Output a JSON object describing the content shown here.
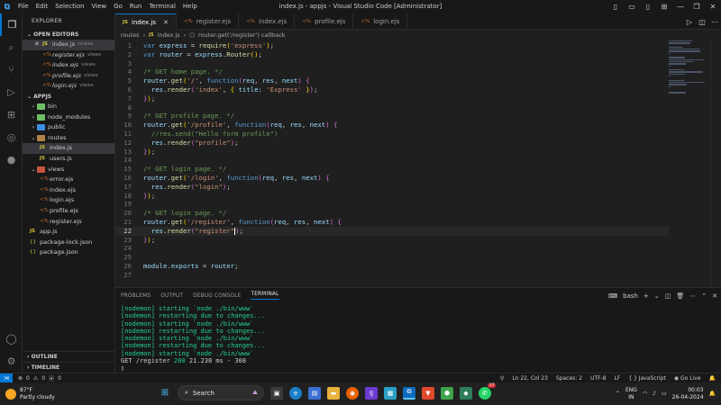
{
  "window": {
    "title": "index.js - appjs - Visual Studio Code [Administrator]",
    "menu": [
      "File",
      "Edit",
      "Selection",
      "View",
      "Go",
      "Run",
      "Terminal",
      "Help"
    ]
  },
  "sidebar": {
    "title": "EXPLORER",
    "open_editors_label": "OPEN EDITORS",
    "open_editors": [
      {
        "icon": "JS",
        "name": "index.js",
        "folder": "routes",
        "selected": true
      },
      {
        "icon": "<%",
        "name": "register.ejs",
        "folder": "views"
      },
      {
        "icon": "<%",
        "name": "index.ejs",
        "folder": "views"
      },
      {
        "icon": "<%",
        "name": "profile.ejs",
        "folder": "views"
      },
      {
        "icon": "<%",
        "name": "login.ejs",
        "folder": "views"
      }
    ],
    "project_label": "APPJS",
    "tree": [
      {
        "chev": "›",
        "name": "bin",
        "folder_color": "#6dbf67",
        "depth": 0
      },
      {
        "chev": "›",
        "name": "node_modules",
        "folder_color": "#6dbf67",
        "depth": 0
      },
      {
        "chev": "›",
        "name": "public",
        "folder_color": "#3d8ee6",
        "depth": 0
      },
      {
        "chev": "⌄",
        "name": "routes",
        "folder_color": "#b1824a",
        "depth": 0
      },
      {
        "icon": "JS",
        "name": "index.js",
        "depth": 1,
        "selected": true
      },
      {
        "icon": "JS",
        "name": "users.js",
        "depth": 1
      },
      {
        "chev": "⌄",
        "name": "views",
        "folder_color": "#c7553c",
        "depth": 0
      },
      {
        "icon": "<%",
        "name": "error.ejs",
        "depth": 1
      },
      {
        "icon": "<%",
        "name": "index.ejs",
        "depth": 1
      },
      {
        "icon": "<%",
        "name": "login.ejs",
        "depth": 1
      },
      {
        "icon": "<%",
        "name": "profile.ejs",
        "depth": 1
      },
      {
        "icon": "<%",
        "name": "register.ejs",
        "depth": 1
      },
      {
        "icon": "JS",
        "name": "app.js",
        "depth": 0
      },
      {
        "icon": "{}",
        "name": "package-lock.json",
        "depth": 0
      },
      {
        "icon": "{}",
        "name": "package.json",
        "depth": 0
      }
    ],
    "outline_label": "OUTLINE",
    "timeline_label": "TIMELINE"
  },
  "tabs": [
    {
      "icon": "JS",
      "name": "index.js",
      "active": true
    },
    {
      "icon": "<%",
      "name": "register.ejs"
    },
    {
      "icon": "<%",
      "name": "index.ejs"
    },
    {
      "icon": "<%",
      "name": "profile.ejs"
    },
    {
      "icon": "<%",
      "name": "login.ejs"
    }
  ],
  "breadcrumb": {
    "folder": "routes",
    "file_icon": "JS",
    "file": "index.js",
    "symbol": "router.get('/register') callback"
  },
  "editor": {
    "current_line": 22,
    "lines": [
      [
        [
          "k",
          "var"
        ],
        [
          "t",
          " "
        ],
        [
          "v",
          "express"
        ],
        [
          "t",
          " = "
        ],
        [
          "f",
          "require"
        ],
        [
          "p",
          "("
        ],
        [
          "s",
          "'express'"
        ],
        [
          "p",
          ")"
        ],
        [
          "t",
          ";"
        ]
      ],
      [
        [
          "k",
          "var"
        ],
        [
          "t",
          " "
        ],
        [
          "v",
          "router"
        ],
        [
          "t",
          " = "
        ],
        [
          "v",
          "express"
        ],
        [
          "t",
          "."
        ],
        [
          "f",
          "Router"
        ],
        [
          "p",
          "()"
        ],
        [
          "t",
          ";"
        ]
      ],
      [],
      [
        [
          "c",
          "/* GET home page. */"
        ]
      ],
      [
        [
          "v",
          "router"
        ],
        [
          "t",
          "."
        ],
        [
          "f",
          "get"
        ],
        [
          "p",
          "("
        ],
        [
          "s",
          "'/'"
        ],
        [
          "t",
          ", "
        ],
        [
          "k",
          "function"
        ],
        [
          "pm",
          "("
        ],
        [
          "v",
          "req"
        ],
        [
          "t",
          ", "
        ],
        [
          "v",
          "res"
        ],
        [
          "t",
          ", "
        ],
        [
          "v",
          "next"
        ],
        [
          "pm",
          ")"
        ],
        [
          "t",
          " "
        ],
        [
          "pm",
          "{"
        ]
      ],
      [
        [
          "t",
          "  "
        ],
        [
          "v",
          "res"
        ],
        [
          "t",
          "."
        ],
        [
          "f",
          "render"
        ],
        [
          "pm",
          "("
        ],
        [
          "s",
          "'index'"
        ],
        [
          "t",
          ", "
        ],
        [
          "p",
          "{"
        ],
        [
          "t",
          " "
        ],
        [
          "v",
          "title"
        ],
        [
          "t",
          ": "
        ],
        [
          "s",
          "'Express'"
        ],
        [
          "t",
          " "
        ],
        [
          "p",
          "}"
        ],
        [
          "pm",
          ")"
        ],
        [
          "t",
          ";"
        ]
      ],
      [
        [
          "pm",
          "}"
        ],
        [
          "p",
          ")"
        ],
        [
          "t",
          ";"
        ]
      ],
      [],
      [
        [
          "c",
          "/* GET profile page. */"
        ]
      ],
      [
        [
          "v",
          "router"
        ],
        [
          "t",
          "."
        ],
        [
          "f",
          "get"
        ],
        [
          "p",
          "("
        ],
        [
          "s",
          "'/profile'"
        ],
        [
          "t",
          ", "
        ],
        [
          "k",
          "function"
        ],
        [
          "pm",
          "("
        ],
        [
          "v",
          "req"
        ],
        [
          "t",
          ", "
        ],
        [
          "v",
          "res"
        ],
        [
          "t",
          ", "
        ],
        [
          "v",
          "next"
        ],
        [
          "pm",
          ")"
        ],
        [
          "t",
          " "
        ],
        [
          "pm",
          "{"
        ]
      ],
      [
        [
          "t",
          "  "
        ],
        [
          "c",
          "//res.send(\"Hello form profile\")"
        ]
      ],
      [
        [
          "t",
          "  "
        ],
        [
          "v",
          "res"
        ],
        [
          "t",
          "."
        ],
        [
          "f",
          "render"
        ],
        [
          "pm",
          "("
        ],
        [
          "s",
          "\"profile\""
        ],
        [
          "pm",
          ")"
        ],
        [
          "t",
          ";"
        ]
      ],
      [
        [
          "pm",
          "}"
        ],
        [
          "p",
          ")"
        ],
        [
          "t",
          ";"
        ]
      ],
      [],
      [
        [
          "c",
          "/* GET login page. */"
        ]
      ],
      [
        [
          "v",
          "router"
        ],
        [
          "t",
          "."
        ],
        [
          "f",
          "get"
        ],
        [
          "p",
          "("
        ],
        [
          "s",
          "'/login'"
        ],
        [
          "t",
          ", "
        ],
        [
          "k",
          "function"
        ],
        [
          "pm",
          "("
        ],
        [
          "v",
          "req"
        ],
        [
          "t",
          ", "
        ],
        [
          "v",
          "res"
        ],
        [
          "t",
          ", "
        ],
        [
          "v",
          "next"
        ],
        [
          "pm",
          ")"
        ],
        [
          "t",
          " "
        ],
        [
          "pm",
          "{"
        ]
      ],
      [
        [
          "t",
          "  "
        ],
        [
          "v",
          "res"
        ],
        [
          "t",
          "."
        ],
        [
          "f",
          "render"
        ],
        [
          "pm",
          "("
        ],
        [
          "s",
          "\"login\""
        ],
        [
          "pm",
          ")"
        ],
        [
          "t",
          ";"
        ]
      ],
      [
        [
          "pm",
          "}"
        ],
        [
          "p",
          ")"
        ],
        [
          "t",
          ";"
        ]
      ],
      [],
      [
        [
          "c",
          "/* GET login page. */"
        ]
      ],
      [
        [
          "v",
          "router"
        ],
        [
          "t",
          "."
        ],
        [
          "f",
          "get"
        ],
        [
          "p",
          "("
        ],
        [
          "s",
          "'/register'"
        ],
        [
          "t",
          ", "
        ],
        [
          "k",
          "function"
        ],
        [
          "pm",
          "("
        ],
        [
          "v",
          "req"
        ],
        [
          "t",
          ", "
        ],
        [
          "v",
          "res"
        ],
        [
          "t",
          ", "
        ],
        [
          "v",
          "next"
        ],
        [
          "pm",
          ")"
        ],
        [
          "t",
          " "
        ],
        [
          "pm",
          "{"
        ]
      ],
      [
        [
          "t",
          "  "
        ],
        [
          "v",
          "res"
        ],
        [
          "t",
          "."
        ],
        [
          "f",
          "render"
        ],
        [
          "pm",
          "("
        ],
        [
          "s",
          "\"register\""
        ],
        [
          "cursor",
          ""
        ],
        [
          "pm",
          ")"
        ],
        [
          "t",
          ";"
        ]
      ],
      [
        [
          "pm",
          "}"
        ],
        [
          "p",
          ")"
        ],
        [
          "t",
          ";"
        ]
      ],
      [],
      [],
      [
        [
          "v",
          "module"
        ],
        [
          "t",
          "."
        ],
        [
          "v",
          "exports"
        ],
        [
          "t",
          " = "
        ],
        [
          "v",
          "router"
        ],
        [
          "t",
          ";"
        ]
      ],
      []
    ]
  },
  "panel": {
    "tabs": [
      "PROBLEMS",
      "OUTPUT",
      "DEBUG CONSOLE",
      "TERMINAL"
    ],
    "active_tab": "TERMINAL",
    "shell": "bash",
    "terminal_lines": [
      "[nodemon] starting `node ./bin/www`",
      "[nodemon] restarting due to changes...",
      "[nodemon] starting `node ./bin/www`",
      "[nodemon] restarting due to changes...",
      "[nodemon] starting `node ./bin/www`",
      "[nodemon] restarting due to changes...",
      "[nodemon] starting `node ./bin/www`"
    ],
    "request_line": {
      "method": "GET /register ",
      "status": "200",
      "rest": " 21.238 ms - 308"
    }
  },
  "statusbar": {
    "errors": "0",
    "warnings": "0",
    "ports": "0",
    "position": "Ln 22, Col 23",
    "spaces": "Spaces: 2",
    "encoding": "UTF-8",
    "eol": "LF",
    "language": "JavaScript",
    "golive": "Go Live"
  },
  "taskbar": {
    "temp": "87°F",
    "condition": "Partly cloudy",
    "search_label": "Search",
    "lang_top": "ENG",
    "lang_bottom": "IN",
    "time": "00:03",
    "date": "26-04-2024",
    "whatsapp_badge": "17"
  }
}
